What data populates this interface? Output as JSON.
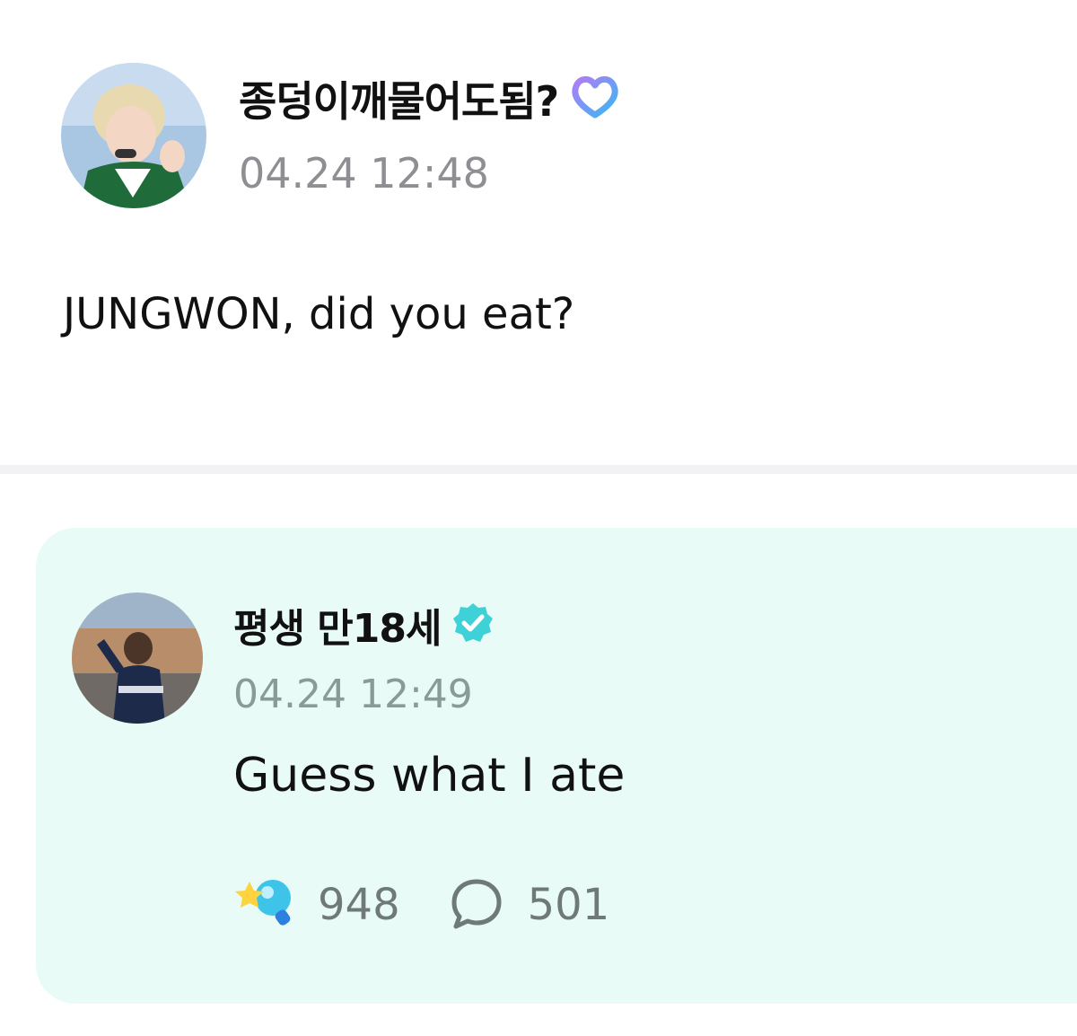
{
  "post": {
    "author": "종덩이깨물어도됨?",
    "badge_icon": "membership-heart-icon",
    "timestamp": "04.24 12:48",
    "text": "JUNGWON, did you eat?"
  },
  "reply": {
    "author": "평생 만18세",
    "badge_icon": "verified-check-icon",
    "timestamp": "04.24 12:49",
    "text": "Guess what I ate",
    "likes": "948",
    "comments": "501",
    "likes_icon": "star-lightstick-icon",
    "comments_icon": "comment-bubble-icon"
  },
  "colors": {
    "reply_background": "#e8fbf6",
    "verified_badge": "#3ed1d7",
    "timestamp_gray": "#8e8e93"
  }
}
